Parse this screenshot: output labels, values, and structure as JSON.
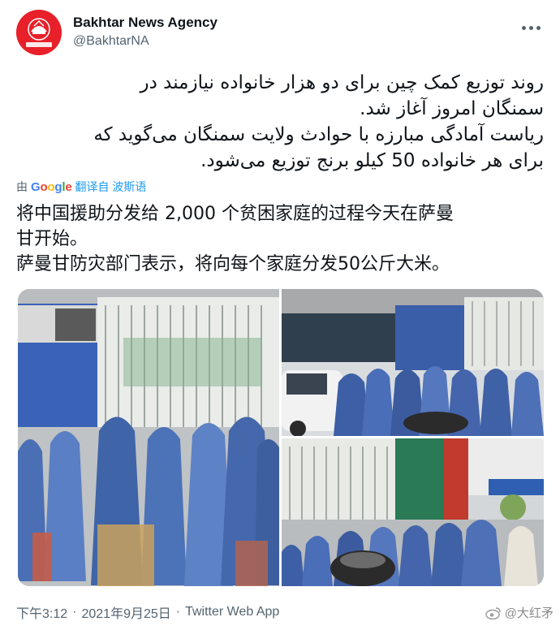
{
  "account": {
    "name": "Bakhtar News Agency",
    "handle": "@BakhtarNA",
    "avatar_logo_text": "BAKHTAR NEWS AGENCY",
    "avatar_color": "#e8202a"
  },
  "more_icon": "ellipsis-icon",
  "tweet_persian": [
    "روند توزیع کمک چین برای دو هزار خانواده نیازمند در",
    "سمنگان امروز آغاز شد.",
    "ریاست آمادگی مبارزه با حوادث ولایت سمنگان می‌گوید که",
    "برای هر خانواده 50 کیلو برنج توزیع می‌شود."
  ],
  "translation": {
    "prefix": "由",
    "provider": "Google",
    "link_text": "翻译自 波斯语"
  },
  "tweet_chinese": [
    "将中国援助分发给 2,000 个贫困家庭的过程今天在萨曼",
    "甘开始。",
    "萨曼甘防灾部门表示，将向每个家庭分发50公斤大米。"
  ],
  "media": {
    "photos": [
      {
        "icon": "photo-crowd-shutter-icon"
      },
      {
        "icon": "photo-crowd-street-icon"
      },
      {
        "icon": "photo-crowd-building-icon"
      }
    ]
  },
  "footer": {
    "time": "下午3:12",
    "date": "2021年9月25日",
    "separator": "·",
    "source": "Twitter Web App"
  },
  "watermark": {
    "text": "@大红矛",
    "icon": "weibo-icon"
  },
  "colors": {
    "text": "#0f1419",
    "secondary": "#536471",
    "link": "#1d9bf0",
    "burqa_blue": "#4a6fb5"
  }
}
